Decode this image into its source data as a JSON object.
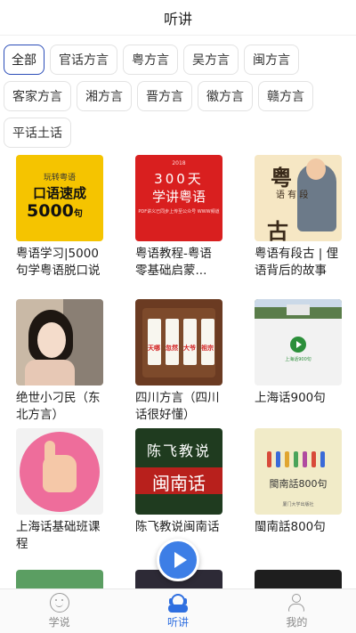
{
  "header": {
    "title": "听讲"
  },
  "filters": {
    "rows": [
      [
        {
          "label": "全部",
          "active": true
        },
        {
          "label": "官话方言",
          "active": false
        },
        {
          "label": "粤方言",
          "active": false
        },
        {
          "label": "吴方言",
          "active": false
        },
        {
          "label": "闽方言",
          "active": false
        }
      ],
      [
        {
          "label": "客家方言",
          "active": false
        },
        {
          "label": "湘方言",
          "active": false
        },
        {
          "label": "晋方言",
          "active": false
        },
        {
          "label": "徽方言",
          "active": false
        },
        {
          "label": "赣方言",
          "active": false
        }
      ],
      [
        {
          "label": "平话土话",
          "active": false
        }
      ]
    ]
  },
  "courses": [
    {
      "title": "粤语学习|5000句学粤语脱口说",
      "cover": {
        "brand": "玩转粤语",
        "line1": "口语速成",
        "line2": "5000",
        "unit": "句"
      }
    },
    {
      "title": "粤语教程-粤语零基础启蒙...",
      "cover": {
        "brand": "2018",
        "line1": "300天",
        "line2": "学讲粤语",
        "sub": "PDF讲义已同步上传至公众号 WWW频道"
      }
    },
    {
      "title": "粤语有段古 | 俚语背后的故事",
      "cover": {
        "c1": "粤",
        "c2": "语 有 段",
        "c3": "古"
      }
    },
    {
      "title": "绝世小刁民（东北方言）",
      "cover": {}
    },
    {
      "title": "四川方言（四川话很好懂）",
      "cover": {
        "tags": [
          "天哪",
          "忽然",
          "大爷",
          "祖宗"
        ]
      }
    },
    {
      "title": "上海话900句",
      "cover": {
        "caption": "上海话900句"
      }
    },
    {
      "title": "上海话基础班课程",
      "cover": {}
    },
    {
      "title": "陈飞教说闽南话",
      "cover": {
        "line1": "陈飞教说",
        "line2": "闽南话"
      }
    },
    {
      "title": "閩南話800句",
      "cover": {
        "line1": "閩南話800句",
        "publisher": "厦门大学出版社"
      }
    }
  ],
  "player": {
    "icon": "play-icon"
  },
  "tabbar": {
    "items": [
      {
        "label": "学说",
        "icon": "smile-face-icon",
        "active": false
      },
      {
        "label": "听讲",
        "icon": "listener-icon",
        "active": true
      },
      {
        "label": "我的",
        "icon": "user-icon",
        "active": false
      }
    ]
  },
  "colors": {
    "accent": "#2f6fe0",
    "active_chip_border": "#2b4db8",
    "play_button": "#3d7ee6",
    "inactive_tab": "#8a8a8a"
  }
}
